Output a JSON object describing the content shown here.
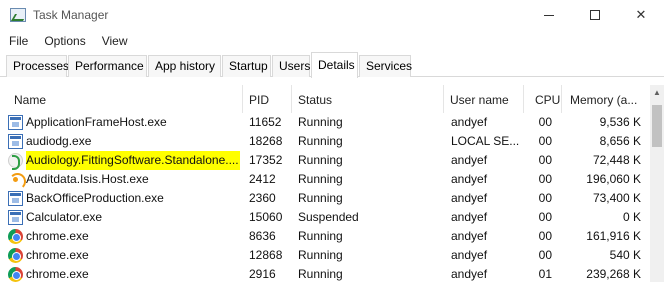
{
  "window": {
    "title": "Task Manager",
    "controls": {
      "minimize": "minimize-icon",
      "maximize": "maximize-icon",
      "close": "✕"
    }
  },
  "menu": [
    "File",
    "Options",
    "View"
  ],
  "tabs": [
    {
      "label": "Processes",
      "active": false
    },
    {
      "label": "Performance",
      "active": false
    },
    {
      "label": "App history",
      "active": false
    },
    {
      "label": "Startup",
      "active": false
    },
    {
      "label": "Users",
      "active": false
    },
    {
      "label": "Details",
      "active": true
    },
    {
      "label": "Services",
      "active": false
    }
  ],
  "columns": {
    "name": "Name",
    "pid": "PID",
    "status": "Status",
    "user": "User name",
    "cpu": "CPU",
    "memory": "Memory (a..."
  },
  "sort_indicator": "^",
  "processes": [
    {
      "icon": "app-window-icon",
      "name": "ApplicationFrameHost.exe",
      "pid": "11652",
      "status": "Running",
      "user": "andyef",
      "cpu": "00",
      "memory": "9,536 K"
    },
    {
      "icon": "app-window-icon",
      "name": "audiodg.exe",
      "pid": "18268",
      "status": "Running",
      "user": "LOCAL SE...",
      "cpu": "00",
      "memory": "8,656 K"
    },
    {
      "icon": "audiology-icon",
      "name": "Audiology.FittingSoftware.Standalone....",
      "pid": "17352",
      "status": "Running",
      "user": "andyef",
      "cpu": "00",
      "memory": "72,448 K",
      "highlighted": true
    },
    {
      "icon": "auditdata-icon",
      "name": "Auditdata.Isis.Host.exe",
      "pid": "2412",
      "status": "Running",
      "user": "andyef",
      "cpu": "00",
      "memory": "196,060 K"
    },
    {
      "icon": "app-window-icon",
      "name": "BackOfficeProduction.exe",
      "pid": "2360",
      "status": "Running",
      "user": "andyef",
      "cpu": "00",
      "memory": "73,400 K"
    },
    {
      "icon": "app-window-icon",
      "name": "Calculator.exe",
      "pid": "15060",
      "status": "Suspended",
      "user": "andyef",
      "cpu": "00",
      "memory": "0 K"
    },
    {
      "icon": "chrome-icon",
      "name": "chrome.exe",
      "pid": "8636",
      "status": "Running",
      "user": "andyef",
      "cpu": "00",
      "memory": "161,916 K"
    },
    {
      "icon": "chrome-icon",
      "name": "chrome.exe",
      "pid": "12868",
      "status": "Running",
      "user": "andyef",
      "cpu": "00",
      "memory": "540 K"
    },
    {
      "icon": "chrome-icon",
      "name": "chrome.exe",
      "pid": "2916",
      "status": "Running",
      "user": "andyef",
      "cpu": "01",
      "memory": "239,268 K"
    }
  ],
  "colors": {
    "highlight": "#ffff00",
    "tab_border": "#d9d9d9",
    "scroll_thumb": "#c2c2c2"
  }
}
